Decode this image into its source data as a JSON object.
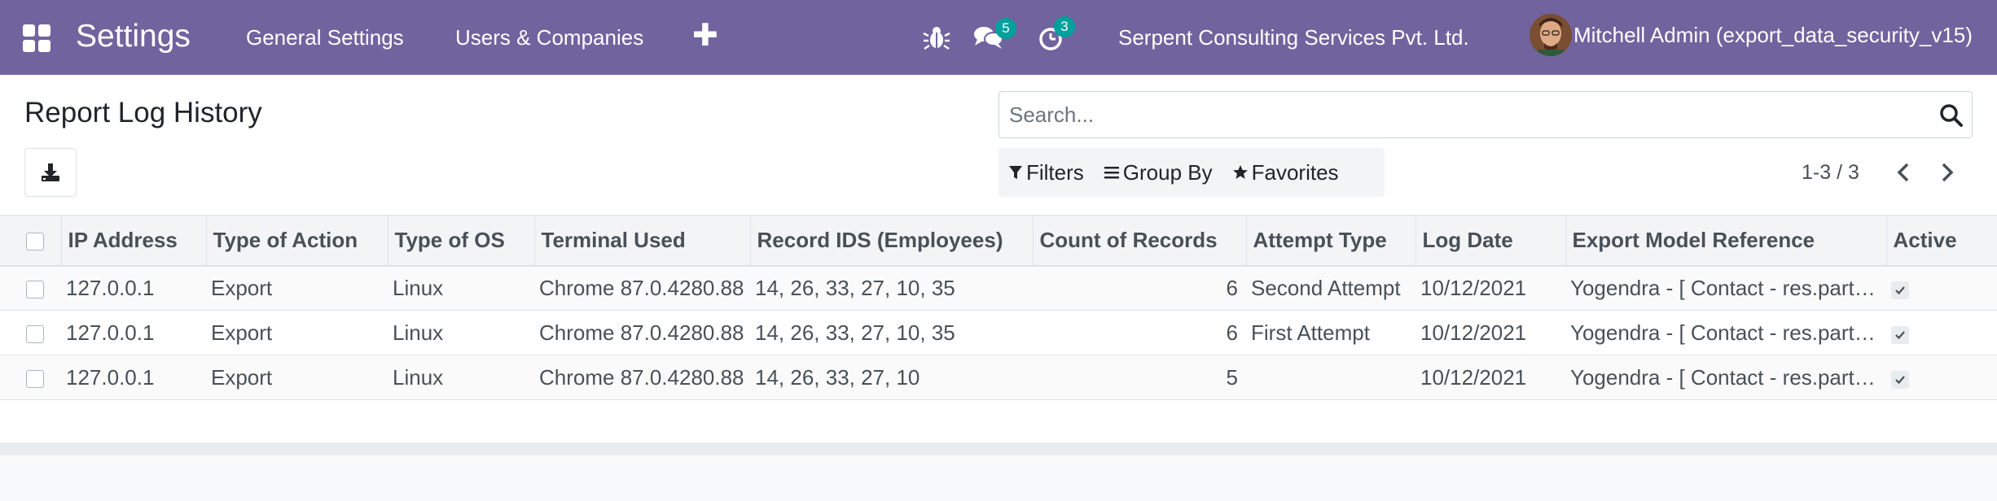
{
  "navbar": {
    "app_title": "Settings",
    "menus": [
      "General Settings",
      "Users & Companies"
    ],
    "plus_label": "✚",
    "messages_count": "5",
    "activities_count": "3",
    "company": "Serpent Consulting Services Pvt. Ltd.",
    "user": "Mitchell Admin (export_data_security_v15)",
    "colors": {
      "navbar_bg": "#71639e",
      "badge": "#00a09d"
    }
  },
  "page": {
    "title": "Report Log History"
  },
  "search": {
    "placeholder": "Search..."
  },
  "filters": {
    "filters_label": "Filters",
    "group_by_label": "Group By",
    "favorites_label": "Favorites"
  },
  "pager": {
    "value": "1-3 / 3"
  },
  "table": {
    "columns": [
      "IP Address",
      "Type of Action",
      "Type of OS",
      "Terminal Used",
      "Record IDS (Employees)",
      "Count of Records",
      "Attempt Type",
      "Log Date",
      "Export Model Reference",
      "Active"
    ],
    "rows": [
      {
        "ip": "127.0.0.1",
        "action": "Export",
        "os": "Linux",
        "terminal": "Chrome 87.0.4280.88",
        "record_ids": "14, 26, 33, 27, 10, 35",
        "count": "6",
        "attempt": "Second Attempt",
        "date": "10/12/2021",
        "model_ref": "Yogendra - [ Contact - res.partner ]",
        "active": true
      },
      {
        "ip": "127.0.0.1",
        "action": "Export",
        "os": "Linux",
        "terminal": "Chrome 87.0.4280.88",
        "record_ids": "14, 26, 33, 27, 10, 35",
        "count": "6",
        "attempt": "First Attempt",
        "date": "10/12/2021",
        "model_ref": "Yogendra - [ Contact - res.partner ]",
        "active": true
      },
      {
        "ip": "127.0.0.1",
        "action": "Export",
        "os": "Linux",
        "terminal": "Chrome 87.0.4280.88",
        "record_ids": "14, 26, 33, 27, 10",
        "count": "5",
        "attempt": "",
        "date": "10/12/2021",
        "model_ref": "Yogendra - [ Contact - res.partner ]",
        "active": true
      }
    ]
  }
}
